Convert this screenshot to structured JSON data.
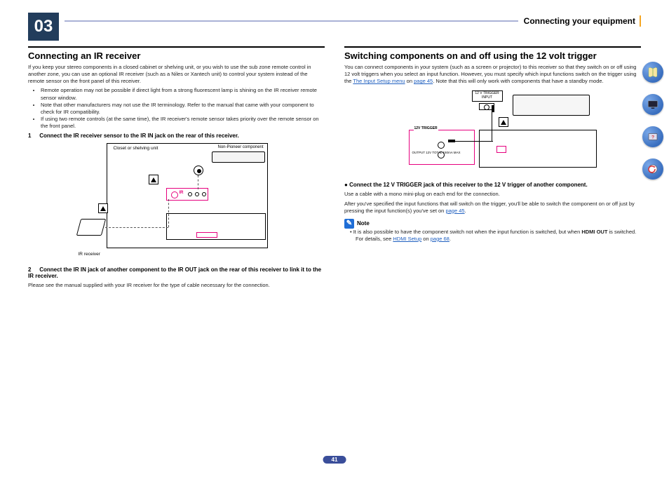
{
  "chapter_num": "03",
  "header_title": "Connecting your equipment",
  "page_number": "41",
  "left": {
    "h2": "Connecting an IR receiver",
    "intro": "If you keep your stereo components in a closed cabinet or shelving unit, or you wish to use the sub zone remote control in another zone, you can use an optional IR receiver (such as a Niles or Xantech unit) to control your system instead of the remote sensor on the front panel of this receiver.",
    "bullets": [
      "Remote operation may not be possible if direct light from a strong fluorescent lamp is shining on the IR receiver remote sensor window.",
      "Note that other manufacturers may not use the IR terminology. Refer to the manual that came with your component to check for IR compatibility.",
      "If using two remote controls (at the same time), the IR receiver's remote sensor takes priority over the remote sensor on the front panel."
    ],
    "step1_num": "1",
    "step1_txt": "Connect the IR receiver sensor to the IR IN jack on the rear of this receiver.",
    "diagram": {
      "shelf_label": "Closet or shelving unit",
      "comp_label": "Non-Pioneer component",
      "ir_label": "IR receiver",
      "ctrl_lbl": "IR"
    },
    "step2_num": "2",
    "step2_txt": "Connect the IR IN jack of another component to the IR OUT jack on the rear of this receiver to link it to the IR receiver.",
    "step2_fine": "Please see the manual supplied with your IR receiver for the type of cable necessary for the connection."
  },
  "right": {
    "h2": "Switching components on and off using the 12 volt trigger",
    "intro_a": "You can connect components in your system (such as a screen or projector) to this receiver so that they switch on or off using 12 volt triggers when you select an input function. However, you must specify which input functions switch on the trigger using the ",
    "intro_link1": "The Input Setup menu",
    "intro_b": " on ",
    "intro_link2": "page 45",
    "intro_c": ". Note that this will only work with components that have a standby mode.",
    "diagram": {
      "sock_label": "12 V TRIGGER INPUT",
      "panel_label": "12V TRIGGER",
      "panel_tiny": "OUTPUT 12V TOTAL 150mA MAX"
    },
    "step_txt": "Connect the 12 V TRIGGER jack of this receiver to the 12 V trigger of another component.",
    "step_fine1": "Use a cable with a mono mini-plug on each end for the connection.",
    "step_fine2a": "After you've specified the input functions that will switch on the trigger, you'll be able to switch the component on or off just by pressing the input function(s) you've set on ",
    "step_fine2_link": "page 45",
    "step_fine2b": ".",
    "note_lbl": "Note",
    "note_a": "It is also possible to have the component switch not when the input function is switched, but when ",
    "note_bold": "HDMI OUT",
    "note_b": " is switched. For details, see ",
    "note_link1": "HDMI Setup",
    "note_c": " on ",
    "note_link2": "page 68",
    "note_d": "."
  },
  "side_icons": [
    "book-icon",
    "screen-icon",
    "help-icon",
    "back-icon"
  ]
}
